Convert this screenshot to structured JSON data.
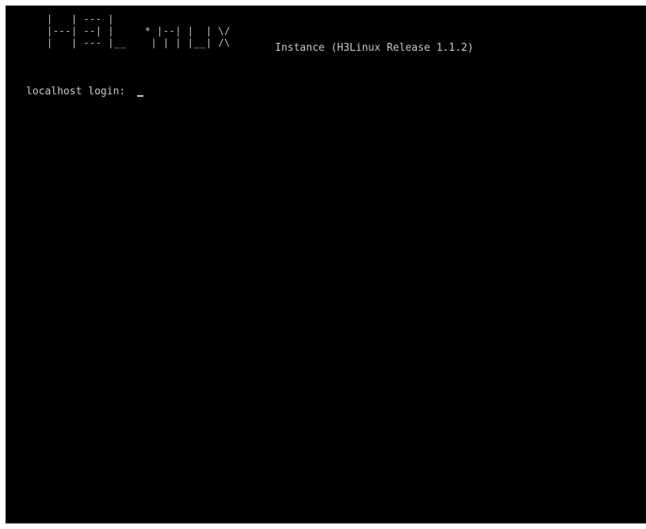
{
  "console": {
    "logo_lines": [
      "|   | --- |",
      "|---| --| |     * |--| |  | \\/",
      "|   | --- |__    | | | |__| /\\"
    ],
    "release_text": "Instance (H3Linux Release 1.1.2)",
    "login_prompt": "localhost login: ",
    "login_value": ""
  },
  "colors": {
    "background": "#000000",
    "text": "#c8c8c8",
    "frame": "#ffffff"
  }
}
